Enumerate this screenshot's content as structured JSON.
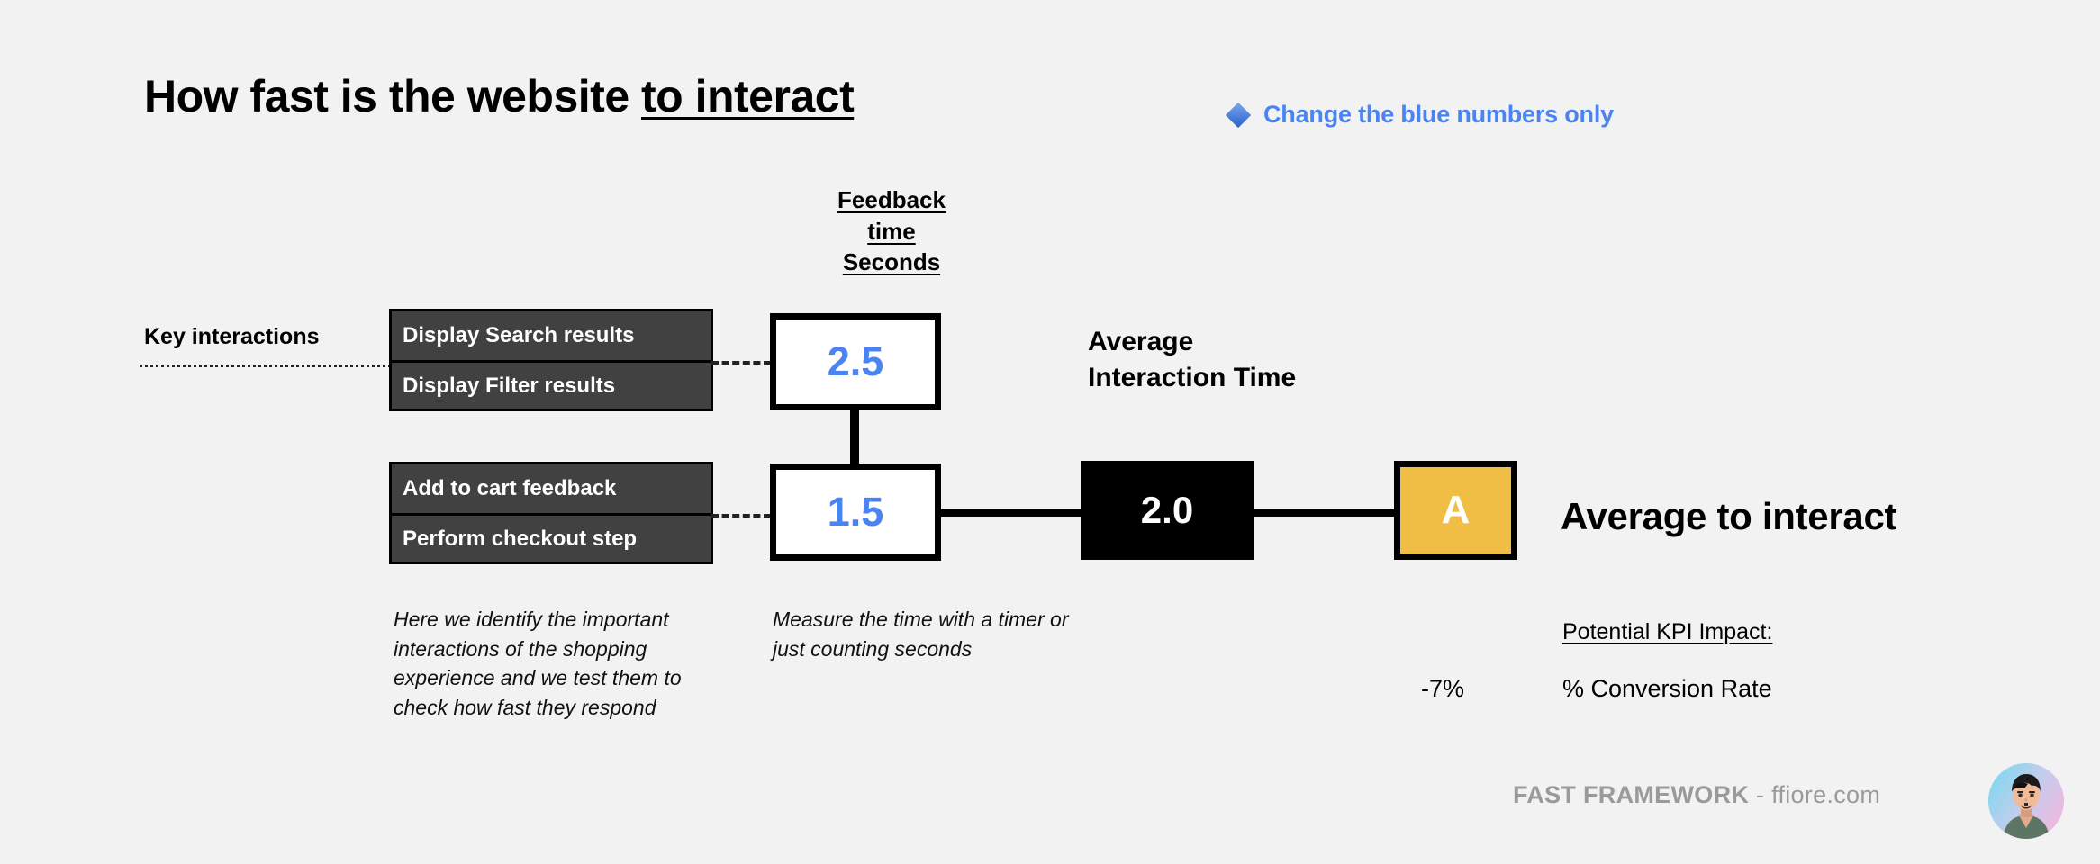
{
  "page": {
    "background_color": "#f2f2f2",
    "title_prefix": "How fast is the website ",
    "title_emphasis": "to interact"
  },
  "note": {
    "icon": "blue-diamond-icon",
    "text": "Change the blue numbers only",
    "color": "#4a84f3"
  },
  "column_header": {
    "line1": "Feedback",
    "line2": "time",
    "line3": "Seconds"
  },
  "key_interactions": {
    "label": "Key interactions",
    "groups": [
      {
        "rows": [
          "Display Search results",
          "Display Filter results"
        ],
        "feedback_time": "2.5"
      },
      {
        "rows": [
          "Add to cart feedback",
          "Perform checkout step"
        ],
        "feedback_time": "1.5"
      }
    ]
  },
  "average": {
    "label_line1": "Average",
    "label_line2": "Interaction Time",
    "value": "2.0"
  },
  "grade": {
    "letter": "A",
    "color": "#f0be45"
  },
  "result": {
    "label": "Average to interact"
  },
  "captions": {
    "left": "Here we identify the important interactions of the shopping experience and we test them to check how fast they respond",
    "middle": "Measure the time with a timer or just counting seconds"
  },
  "kpi": {
    "title": "Potential KPI Impact:",
    "value": "-7%",
    "metric": "% Conversion Rate"
  },
  "footer": {
    "brand": "FAST FRAMEWORK",
    "site": " - ffiore.com",
    "avatar": "profile-avatar"
  },
  "chart_data": {
    "type": "diagram",
    "title": "How fast is the website to interact",
    "metric_name": "Feedback time Seconds",
    "categories": [
      "Display Search results / Display Filter results",
      "Add to cart feedback / Perform checkout step"
    ],
    "values": [
      2.5,
      1.5
    ],
    "aggregate_label": "Average Interaction Time",
    "aggregate_value": 2.0,
    "grade": "A",
    "kpi_impact": -7,
    "kpi_metric": "% Conversion Rate"
  }
}
